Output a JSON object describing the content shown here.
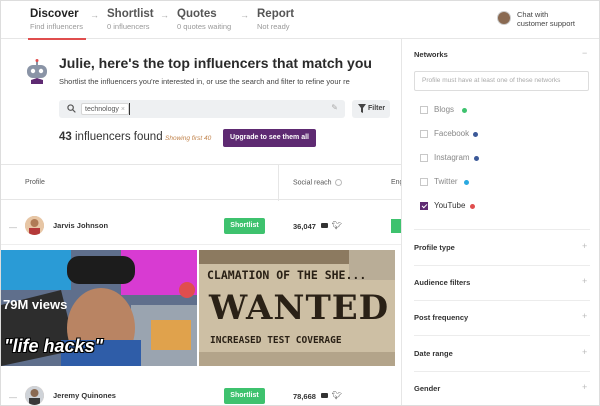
{
  "steps": [
    {
      "title": "Discover",
      "subtitle": "Find influencers"
    },
    {
      "title": "Shortlist",
      "subtitle": "0 influencers"
    },
    {
      "title": "Quotes",
      "subtitle": "0 quotes waiting"
    },
    {
      "title": "Report",
      "subtitle": "Not ready"
    }
  ],
  "chat": {
    "line1": "Chat with",
    "line2": "customer support"
  },
  "hero": {
    "greeting": "Julie, here's the top influencers that match you",
    "subtitle": "Shortlist the influencers you're interested in, or use the  search and  filter to refine your re"
  },
  "search": {
    "chip": "technology",
    "chip_close": "×",
    "filter_label": "Filter"
  },
  "results": {
    "count": "43",
    "count_label": "influencers found",
    "showing": "Showing first 40",
    "upgrade": "Upgrade to see them all"
  },
  "table": {
    "headers": {
      "profile": "Profile",
      "reach": "Social reach",
      "engagement": "Eng"
    },
    "rows": [
      {
        "name": "Jarvis Johnson",
        "reach": "36,047",
        "action": "Shortlist"
      },
      {
        "name": "Jeremy Quinones",
        "reach": "78,668",
        "action": "Shortlist"
      }
    ]
  },
  "thumbnails": {
    "left": {
      "views": "79M views",
      "caption": "\"life hacks\""
    },
    "right": {
      "line1": "CLAMATION OF THE SHE...",
      "headline": "WANTED",
      "line3": "INCREASED TEST COVERAGE"
    }
  },
  "panel": {
    "networks_title": "Networks",
    "networks_toggle": "−",
    "networks_placeholder": "Profile must have at least one of these networks",
    "networks": [
      {
        "label": "Blogs",
        "checked": false,
        "color": "#3ec26e"
      },
      {
        "label": "Facebook",
        "checked": false,
        "color": "#3b5998"
      },
      {
        "label": "Instagram",
        "checked": false,
        "color": "#3b5998"
      },
      {
        "label": "Twitter",
        "checked": false,
        "color": "#2aa9e0"
      },
      {
        "label": "YouTube",
        "checked": true,
        "color": "#e04e4e"
      }
    ],
    "sections": [
      {
        "title": "Profile type",
        "toggle": "+"
      },
      {
        "title": "Audience filters",
        "toggle": "+"
      },
      {
        "title": "Post frequency",
        "toggle": "+"
      },
      {
        "title": "Date range",
        "toggle": "+"
      },
      {
        "title": "Gender",
        "toggle": "+"
      }
    ]
  },
  "colors": {
    "accent": "#5e2a72",
    "green": "#3ec26e",
    "active_underline": "#e04e4e"
  }
}
